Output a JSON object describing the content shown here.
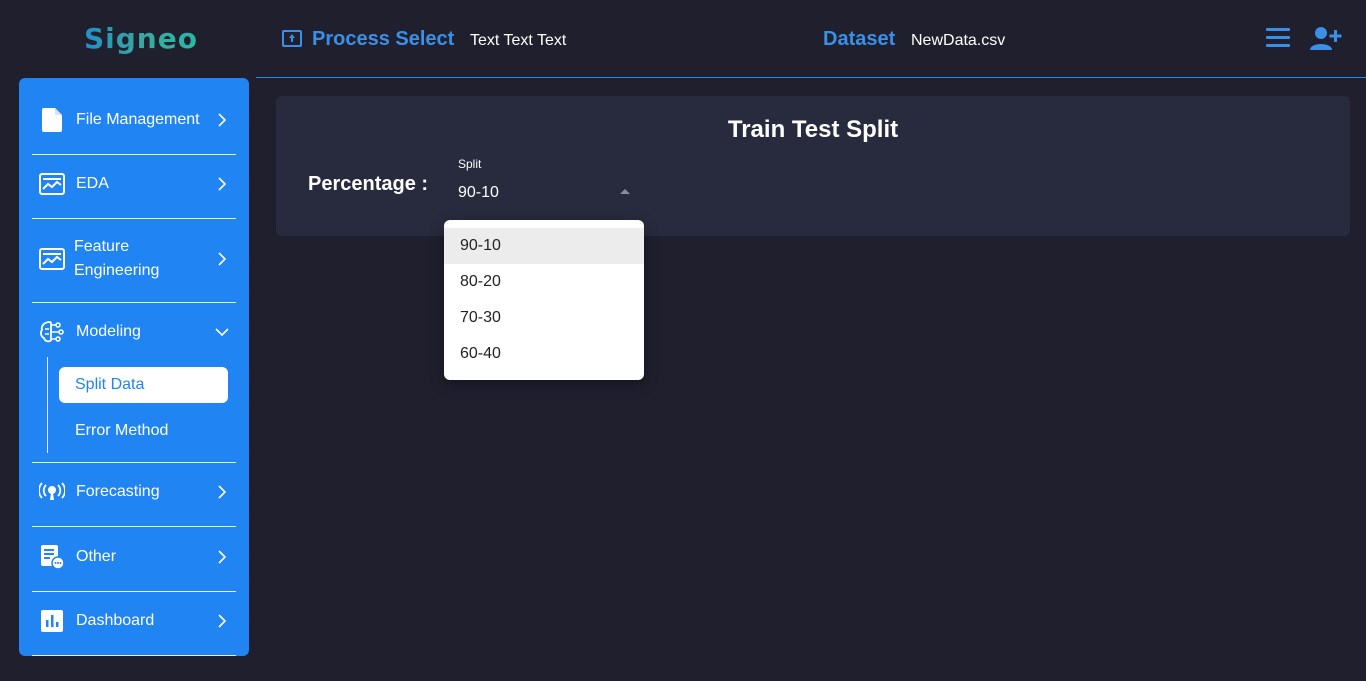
{
  "app": {
    "logo": "Signeo"
  },
  "header": {
    "process_title": "Process Select",
    "process_text": "Text Text Text",
    "dataset_title": "Dataset",
    "dataset_value": "NewData.csv"
  },
  "colors": {
    "accent": "#2085f2",
    "background": "#1f1f2e",
    "card": "#282b3d"
  },
  "sidebar": {
    "items": [
      {
        "label": "File Management",
        "icon": "file-icon"
      },
      {
        "label": "EDA",
        "icon": "chart-board-icon"
      },
      {
        "label": "Feature",
        "label2": "Engineering",
        "icon": "chart-board-icon"
      },
      {
        "label": "Modeling",
        "icon": "brain-circuit-icon",
        "expanded": true,
        "children": [
          {
            "label": "Split Data",
            "active": true
          },
          {
            "label": "Error Method"
          }
        ]
      },
      {
        "label": "Forecasting",
        "icon": "broadcast-icon"
      },
      {
        "label": "Other",
        "icon": "document-chat-icon"
      },
      {
        "label": "Dashboard",
        "icon": "bar-chart-icon"
      }
    ]
  },
  "main": {
    "title": "Train Test Split",
    "percentage_label": "Percentage :",
    "select": {
      "label": "Split",
      "value": "90-10",
      "options": [
        "90-10",
        "80-20",
        "70-30",
        "60-40"
      ]
    }
  }
}
